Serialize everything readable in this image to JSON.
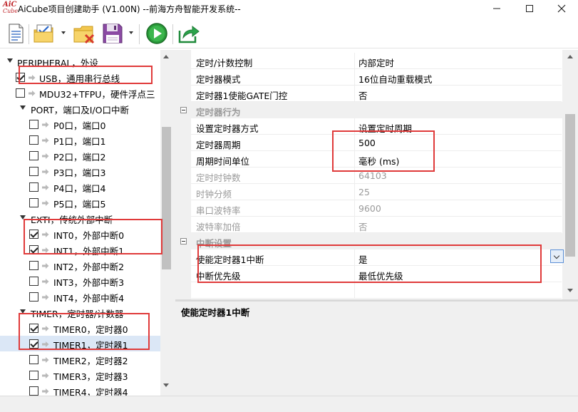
{
  "window": {
    "logo_line1": "AiC",
    "logo_line2": "Cube",
    "title": "AiCube项目创建助手 (V1.00N) --前海方舟智能开发系统--"
  },
  "toolbar": {
    "buttons": [
      "new-project",
      "open-project",
      "close-project",
      "save-project",
      "run",
      "export"
    ]
  },
  "tree": {
    "items": [
      {
        "label": "PERIPHERAL，外设",
        "checked": false
      },
      {
        "label": "USB，通用串行总线",
        "checked": true
      },
      {
        "label": "MDU32+TFPU，硬件浮点三",
        "checked": false
      },
      {
        "label": "PORT，端口及I/O口中断",
        "checked": false
      },
      {
        "label": "P0口，端口0",
        "checked": false
      },
      {
        "label": "P1口，端口1",
        "checked": false
      },
      {
        "label": "P2口，端口2",
        "checked": false
      },
      {
        "label": "P3口，端口3",
        "checked": false
      },
      {
        "label": "P4口，端口4",
        "checked": false
      },
      {
        "label": "P5口，端口5",
        "checked": false
      },
      {
        "label": "EXTI，传统外部中断",
        "checked": false
      },
      {
        "label": "INT0，外部中断0",
        "checked": true
      },
      {
        "label": "INT1，外部中断1",
        "checked": true
      },
      {
        "label": "INT2，外部中断2",
        "checked": false
      },
      {
        "label": "INT3，外部中断3",
        "checked": false
      },
      {
        "label": "INT4，外部中断4",
        "checked": false
      },
      {
        "label": "TIMER，定时器/计数器",
        "checked": false
      },
      {
        "label": "TIMER0，定时器0",
        "checked": true
      },
      {
        "label": "TIMER1，定时器1",
        "checked": true,
        "selected": true
      },
      {
        "label": "TIMER2，定时器2",
        "checked": false
      },
      {
        "label": "TIMER3，定时器3",
        "checked": false
      },
      {
        "label": "TIMER4，定时器4",
        "checked": false
      }
    ]
  },
  "grid": {
    "rows": [
      {
        "name": "定时/计数控制",
        "value": "内部定时"
      },
      {
        "name": "定时器模式",
        "value": "16位自动重载模式"
      },
      {
        "name": "定时器1使能GATE门控",
        "value": "否"
      }
    ],
    "categories": [
      {
        "title": "定时器行为"
      },
      {
        "title": "中断设置"
      }
    ],
    "behavior": [
      {
        "name": "设置定时器方式",
        "value": "设置定时周期"
      },
      {
        "name": "定时器周期",
        "value": "500"
      },
      {
        "name": "周期时间单位",
        "value": "毫秒 (ms)"
      },
      {
        "name": "定时时钟数",
        "value": "64103"
      },
      {
        "name": "时钟分频",
        "value": "25"
      },
      {
        "name": "串口波特率",
        "value": "9600"
      },
      {
        "name": "波特率加倍",
        "value": "否"
      }
    ],
    "interrupt": [
      {
        "name": "使能定时器1中断",
        "value": "是"
      },
      {
        "name": "中断优先级",
        "value": "最低优先级"
      }
    ]
  },
  "description": {
    "title": "使能定时器1中断"
  }
}
